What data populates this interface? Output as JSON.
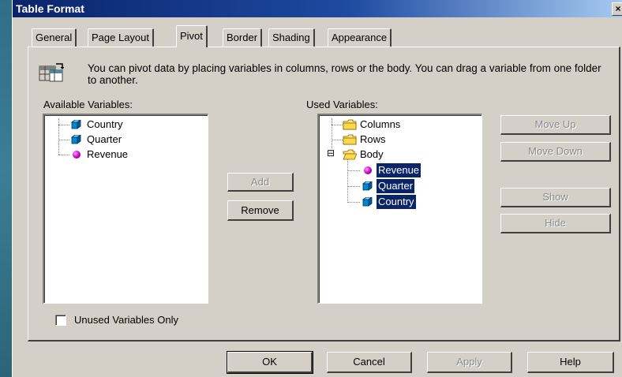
{
  "window": {
    "title": "Table Format",
    "close_label": "×"
  },
  "tabs": [
    {
      "label": "General"
    },
    {
      "label": "Page Layout"
    },
    {
      "label": "Pivot"
    },
    {
      "label": "Border"
    },
    {
      "label": "Shading"
    },
    {
      "label": "Appearance"
    }
  ],
  "active_tab": "Pivot",
  "info": {
    "text": "You can pivot data by placing variables in columns, rows or the body. You can drag a variable from one folder to another.",
    "icon": "pivot-table-icon"
  },
  "available": {
    "label": "Available Variables:",
    "items": [
      {
        "label": "Country",
        "icon": "cube-icon"
      },
      {
        "label": "Quarter",
        "icon": "cube-icon"
      },
      {
        "label": "Revenue",
        "icon": "ball-icon"
      }
    ]
  },
  "used": {
    "label": "Used Variables:",
    "folders": [
      {
        "label": "Columns",
        "icon": "folder-icon"
      },
      {
        "label": "Rows",
        "icon": "folder-icon"
      },
      {
        "label": "Body",
        "icon": "open-folder-icon",
        "expanded": true
      }
    ],
    "body_items": [
      {
        "label": "Revenue",
        "icon": "ball-icon",
        "selected": true
      },
      {
        "label": "Quarter",
        "icon": "cube-icon",
        "selected": true
      },
      {
        "label": "Country",
        "icon": "cube-icon",
        "selected": true
      }
    ],
    "expander": "⊟"
  },
  "buttons": {
    "add": "Add",
    "remove": "Remove",
    "move_up": "Move Up",
    "move_down": "Move Down",
    "show": "Show",
    "hide": "Hide",
    "ok": "OK",
    "cancel": "Cancel",
    "apply": "Apply",
    "help": "Help"
  },
  "unused_only": {
    "label": "Unused Variables Only",
    "checked": false
  },
  "colors": {
    "selection": "#0a246a",
    "face": "#d4d0c8",
    "titlebar_start": "#0a246a",
    "titlebar_end": "#a6caf0"
  }
}
